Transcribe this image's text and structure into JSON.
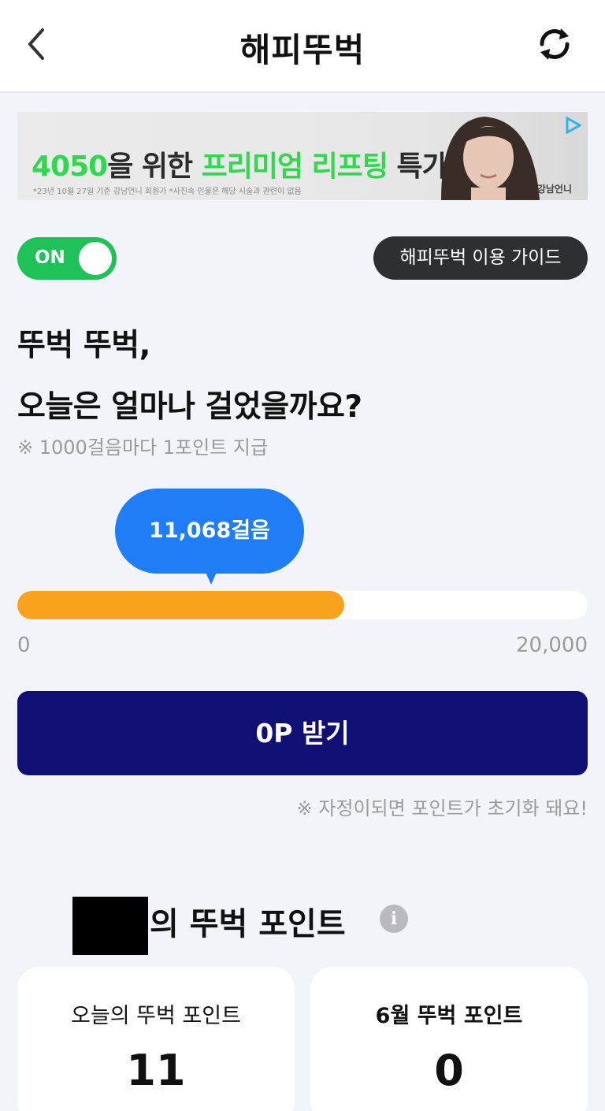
{
  "header": {
    "title": "해피뚜벅"
  },
  "ad": {
    "headline_part1": "4050",
    "headline_part2": "을 위한 ",
    "headline_part3": "프리미엄 리프팅",
    "headline_part4": " 특가",
    "fine_print": "*23년 10월 27일 기준 강남언니 회원가 *사진속 인물은 해당 시술과 관련이 없음",
    "brand": "강남언니",
    "colors": {
      "highlight": "#2fd84c",
      "text": "#2b2b2b"
    }
  },
  "toggle": {
    "label": "ON",
    "state": "on",
    "color": "#1fc259"
  },
  "guide_button": {
    "label": "해피뚜벅 이용 가이드"
  },
  "main": {
    "headline_line1": "뚜벅 뚜벅,",
    "headline_line2": "오늘은 얼마나 걸었을까요?",
    "notice": "※ 1000걸음마다 1포인트 지급"
  },
  "steps": {
    "bubble": "11,068걸음",
    "current": 11068,
    "max": 20000,
    "progress_fraction": 0.573,
    "scale_min": "0",
    "scale_max": "20,000",
    "bar_color": "#f9a21b",
    "bubble_color": "#1f7ef5"
  },
  "claim": {
    "label": "0P 받기",
    "color": "#101074"
  },
  "reset_note": "※ 자정이되면 포인트가 초기화 돼요!",
  "points": {
    "title_suffix": "의 뚜벅 포인트",
    "info_glyph": "i",
    "today_label": "오늘의 뚜벅 포인트",
    "today_value": "11",
    "month_label": "6월 뚜벅 포인트",
    "month_value": "0"
  }
}
